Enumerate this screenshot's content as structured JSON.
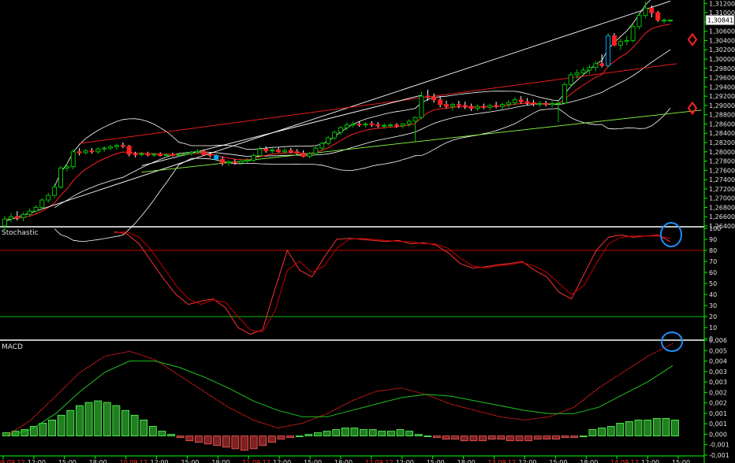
{
  "chart_data": [
    {
      "type": "candlestick",
      "title": "",
      "last_price_label": "1,30841",
      "price_axis_ticks": [
        "1,31200",
        "1,31000",
        "1,30800",
        "1,30600",
        "1,30400",
        "1,30200",
        "1,30000",
        "1,29800",
        "1,29600",
        "1,29400",
        "1,29200",
        "1,29000",
        "1,28800",
        "1,28600",
        "1,28400",
        "1,28200",
        "1,28000",
        "1,27800",
        "1,27600",
        "1,27400",
        "1,27200",
        "1,27000",
        "1,26800",
        "1,26600",
        "1,26400"
      ],
      "ylim": [
        1.264,
        1.3124
      ],
      "bar_count": 108,
      "ohlc": [
        [
          1.264,
          1.2662,
          1.263,
          1.2655
        ],
        [
          1.2655,
          1.2668,
          1.2648,
          1.266
        ],
        [
          1.266,
          1.2672,
          1.2652,
          1.2658
        ],
        [
          1.2658,
          1.267,
          1.265,
          1.2665
        ],
        [
          1.2665,
          1.2678,
          1.266,
          1.2672
        ],
        [
          1.2672,
          1.2685,
          1.2668,
          1.268
        ],
        [
          1.268,
          1.27,
          1.2676,
          1.2696
        ],
        [
          1.2696,
          1.2712,
          1.269,
          1.2706
        ],
        [
          1.2706,
          1.273,
          1.27,
          1.2724
        ],
        [
          1.2724,
          1.277,
          1.272,
          1.2765
        ],
        [
          1.2765,
          1.2775,
          1.2758,
          1.2768
        ],
        [
          1.2768,
          1.2806,
          1.2762,
          1.28
        ],
        [
          1.28,
          1.2808,
          1.2792,
          1.2798
        ],
        [
          1.2798,
          1.2806,
          1.2794,
          1.2802
        ],
        [
          1.2802,
          1.2808,
          1.2796,
          1.28
        ],
        [
          1.28,
          1.281,
          1.2795,
          1.2806
        ],
        [
          1.2806,
          1.2812,
          1.28,
          1.2808
        ],
        [
          1.2808,
          1.2815,
          1.2803,
          1.2811
        ],
        [
          1.2811,
          1.2818,
          1.2805,
          1.2814
        ],
        [
          1.2814,
          1.282,
          1.2808,
          1.2812
        ],
        [
          1.2812,
          1.2815,
          1.279,
          1.2795
        ],
        [
          1.2795,
          1.28,
          1.2788,
          1.2794
        ],
        [
          1.2794,
          1.28,
          1.279,
          1.2796
        ],
        [
          1.2796,
          1.28,
          1.279,
          1.2793
        ],
        [
          1.2793,
          1.2798,
          1.2789,
          1.2795
        ],
        [
          1.2795,
          1.2799,
          1.279,
          1.2792
        ],
        [
          1.2792,
          1.2797,
          1.2788,
          1.2794
        ],
        [
          1.2794,
          1.2798,
          1.279,
          1.2792
        ],
        [
          1.2792,
          1.2796,
          1.2789,
          1.2794
        ],
        [
          1.2794,
          1.2799,
          1.2791,
          1.2796
        ],
        [
          1.2796,
          1.2802,
          1.2792,
          1.2799
        ],
        [
          1.2799,
          1.2806,
          1.2795,
          1.2801
        ],
        [
          1.2801,
          1.2804,
          1.2792,
          1.2794
        ],
        [
          1.2794,
          1.2799,
          1.2788,
          1.2792
        ],
        [
          1.2792,
          1.2796,
          1.278,
          1.2784
        ],
        [
          1.2784,
          1.279,
          1.277,
          1.2776
        ],
        [
          1.2776,
          1.2782,
          1.277,
          1.2778
        ],
        [
          1.2778,
          1.2784,
          1.2772,
          1.2776
        ],
        [
          1.2776,
          1.2784,
          1.2772,
          1.278
        ],
        [
          1.278,
          1.2786,
          1.2776,
          1.2782
        ],
        [
          1.2782,
          1.2796,
          1.2778,
          1.2792
        ],
        [
          1.2792,
          1.2812,
          1.2788,
          1.2806
        ],
        [
          1.2806,
          1.2812,
          1.2798,
          1.2802
        ],
        [
          1.2802,
          1.2808,
          1.2796,
          1.2804
        ],
        [
          1.2804,
          1.281,
          1.2798,
          1.28
        ],
        [
          1.28,
          1.2808,
          1.2796,
          1.2803
        ],
        [
          1.2803,
          1.2808,
          1.2797,
          1.28
        ],
        [
          1.28,
          1.2806,
          1.2794,
          1.2797
        ],
        [
          1.2797,
          1.2803,
          1.2788,
          1.279
        ],
        [
          1.279,
          1.28,
          1.2786,
          1.2796
        ],
        [
          1.2796,
          1.2812,
          1.2792,
          1.2808
        ],
        [
          1.2808,
          1.2822,
          1.2804,
          1.2818
        ],
        [
          1.2818,
          1.2834,
          1.2814,
          1.283
        ],
        [
          1.283,
          1.2846,
          1.2826,
          1.2842
        ],
        [
          1.2842,
          1.2856,
          1.2836,
          1.2852
        ],
        [
          1.2852,
          1.2864,
          1.2846,
          1.2858
        ],
        [
          1.2858,
          1.2866,
          1.2852,
          1.286
        ],
        [
          1.286,
          1.2866,
          1.2854,
          1.2858
        ],
        [
          1.2858,
          1.2864,
          1.2852,
          1.286
        ],
        [
          1.286,
          1.2866,
          1.2854,
          1.2858
        ],
        [
          1.2858,
          1.2864,
          1.2852,
          1.2856
        ],
        [
          1.2856,
          1.2862,
          1.285,
          1.2857
        ],
        [
          1.2857,
          1.2862,
          1.2852,
          1.2858
        ],
        [
          1.2858,
          1.2862,
          1.2852,
          1.2856
        ],
        [
          1.2856,
          1.2862,
          1.285,
          1.286
        ],
        [
          1.286,
          1.287,
          1.2854,
          1.2866
        ],
        [
          1.2866,
          1.2876,
          1.2822,
          1.2874
        ],
        [
          1.2874,
          1.293,
          1.287,
          1.292
        ],
        [
          1.292,
          1.2934,
          1.291,
          1.2918
        ],
        [
          1.2918,
          1.2926,
          1.2906,
          1.2912
        ],
        [
          1.2912,
          1.292,
          1.2896,
          1.2902
        ],
        [
          1.2902,
          1.291,
          1.2894,
          1.2898
        ],
        [
          1.2898,
          1.2906,
          1.289,
          1.2902
        ],
        [
          1.2902,
          1.291,
          1.2894,
          1.29
        ],
        [
          1.29,
          1.2908,
          1.2892,
          1.2898
        ],
        [
          1.2898,
          1.2904,
          1.2888,
          1.2894
        ],
        [
          1.2894,
          1.2902,
          1.2888,
          1.2898
        ],
        [
          1.2898,
          1.2904,
          1.2892,
          1.2896
        ],
        [
          1.2896,
          1.2904,
          1.289,
          1.29
        ],
        [
          1.29,
          1.2908,
          1.2894,
          1.2898
        ],
        [
          1.2898,
          1.2906,
          1.2892,
          1.2902
        ],
        [
          1.2902,
          1.2912,
          1.2896,
          1.2906
        ],
        [
          1.2906,
          1.2918,
          1.29,
          1.2912
        ],
        [
          1.2912,
          1.292,
          1.2904,
          1.2908
        ],
        [
          1.2908,
          1.2916,
          1.29,
          1.2906
        ],
        [
          1.2906,
          1.2912,
          1.2898,
          1.2903
        ],
        [
          1.2903,
          1.291,
          1.2896,
          1.2904
        ],
        [
          1.2904,
          1.291,
          1.2898,
          1.2902
        ],
        [
          1.2902,
          1.291,
          1.2896,
          1.2904
        ],
        [
          1.2904,
          1.291,
          1.2864,
          1.2905
        ],
        [
          1.2905,
          1.295,
          1.2902,
          1.2945
        ],
        [
          1.2945,
          1.2972,
          1.294,
          1.2966
        ],
        [
          1.2966,
          1.2978,
          1.2958,
          1.297
        ],
        [
          1.297,
          1.2982,
          1.2962,
          1.2976
        ],
        [
          1.2976,
          1.2988,
          1.2968,
          1.2982
        ],
        [
          1.2982,
          1.2996,
          1.2974,
          1.299
        ],
        [
          1.299,
          1.301,
          1.2982,
          1.2986
        ],
        [
          1.2986,
          1.3056,
          1.2982,
          1.305
        ],
        [
          1.305,
          1.3056,
          1.3028,
          1.303
        ],
        [
          1.303,
          1.3044,
          1.302,
          1.3038
        ],
        [
          1.3038,
          1.305,
          1.303,
          1.304
        ],
        [
          1.304,
          1.3076,
          1.3036,
          1.307
        ],
        [
          1.307,
          1.31,
          1.3064,
          1.3094
        ],
        [
          1.3094,
          1.3124,
          1.3088,
          1.311
        ],
        [
          1.311,
          1.3116,
          1.309,
          1.31
        ],
        [
          1.31,
          1.3104,
          1.308,
          1.3084
        ],
        [
          1.3084,
          1.3088,
          1.3076,
          1.3084
        ],
        [
          1.3084,
          1.3086,
          1.308,
          1.3084
        ]
      ],
      "highlighted_bars": [
        34,
        97
      ],
      "signal_markers": [
        1.3042,
        1.2894
      ]
    },
    {
      "type": "line",
      "title": "Stochastic",
      "ylim": [
        0,
        100
      ],
      "axis_ticks": [
        "100",
        "90",
        "80",
        "70",
        "60",
        "50",
        "40",
        "30",
        "20",
        "10",
        "0"
      ],
      "levels": [
        80,
        20
      ],
      "series": [
        {
          "values": [
            97,
            95,
            86,
            70,
            54,
            40,
            31,
            34,
            36,
            28,
            10,
            4,
            8,
            45,
            80,
            62,
            56,
            74,
            90,
            91,
            90,
            89,
            88,
            89,
            86,
            87,
            85,
            78,
            68,
            64,
            65,
            67,
            68,
            70,
            62,
            56,
            42,
            36,
            58,
            80,
            92,
            94,
            92,
            93,
            94,
            88
          ]
        },
        {
          "values": [
            96,
            97,
            92,
            80,
            64,
            48,
            36,
            31,
            35,
            33,
            20,
            8,
            6,
            25,
            62,
            70,
            60,
            66,
            82,
            90,
            91,
            90,
            89,
            88,
            88,
            86,
            86,
            82,
            73,
            66,
            64,
            66,
            67,
            69,
            66,
            60,
            50,
            40,
            48,
            68,
            86,
            92,
            93,
            93,
            93,
            91
          ]
        }
      ]
    },
    {
      "type": "bar+line",
      "title": "MACD",
      "ylim": [
        -0.0012,
        0.006
      ],
      "axis_ticks": [
        "0,006",
        "0,005",
        "0,004",
        "0,003",
        "0,003",
        "0,002",
        "0,002",
        "0,001",
        "0,001",
        "0,000",
        "-0,001",
        "-0,001"
      ],
      "histogram": [
        0.0002,
        0.0003,
        0.0004,
        0.0006,
        0.0008,
        0.001,
        0.0013,
        0.0016,
        0.0019,
        0.0021,
        0.0022,
        0.0021,
        0.0019,
        0.0016,
        0.0013,
        0.001,
        0.0006,
        0.0003,
        0.0001,
        -0.0001,
        -0.0003,
        -0.0004,
        -0.0005,
        -0.0006,
        -0.0007,
        -0.0008,
        -0.0009,
        -0.0008,
        -0.0006,
        -0.0004,
        -0.0002,
        -0.0001,
        0.0,
        0.0001,
        0.0002,
        0.0003,
        0.0004,
        0.0005,
        0.0005,
        0.0004,
        0.0004,
        0.0003,
        0.0003,
        0.0004,
        0.0003,
        0.0001,
        0.0,
        -0.0001,
        -0.0002,
        -0.0002,
        -0.0003,
        -0.0003,
        -0.0003,
        -0.0002,
        -0.0002,
        -0.0003,
        -0.0003,
        -0.0003,
        -0.0002,
        -0.0002,
        -0.0002,
        -0.0001,
        -0.0001,
        0.0,
        0.0004,
        0.0005,
        0.0006,
        0.0008,
        0.0009,
        0.001,
        0.001,
        0.0011,
        0.0011,
        0.001
      ],
      "series": [
        {
          "values": [
            0.0,
            0.001,
            0.0025,
            0.004,
            0.005,
            0.0053,
            0.0048,
            0.0038,
            0.0028,
            0.0018,
            0.001,
            0.0005,
            0.0008,
            0.0014,
            0.0022,
            0.0028,
            0.003,
            0.0026,
            0.002,
            0.0016,
            0.0012,
            0.001,
            0.0012,
            0.0018,
            0.003,
            0.004,
            0.005,
            0.0058
          ]
        },
        {
          "values": [
            0.0,
            0.0004,
            0.0014,
            0.0028,
            0.004,
            0.0047,
            0.0047,
            0.0043,
            0.0037,
            0.003,
            0.0022,
            0.0016,
            0.0012,
            0.0012,
            0.0016,
            0.002,
            0.0024,
            0.0026,
            0.0025,
            0.0022,
            0.0019,
            0.0016,
            0.0014,
            0.0014,
            0.0018,
            0.0026,
            0.0034,
            0.0044
          ]
        }
      ]
    }
  ],
  "x_axis_labels": [
    "09.09.12",
    "12:00",
    "15:00",
    "18:00",
    "10.09.12",
    "12:00",
    "15:00",
    "18:00",
    "11.09.12",
    "12:00",
    "15:00",
    "18:00",
    "12.09.12",
    "12:00",
    "15:00",
    "18:00",
    "13.09.12",
    "12:00",
    "15:00",
    "18:00",
    "14.09.12",
    "12:00",
    "15:00"
  ],
  "colors": {
    "bull": "#00c000",
    "bear": "#ff2020",
    "highlight": "#00aaff",
    "axis": "#00ff00",
    "ema": "#ff2020",
    "band": "#ffffff",
    "trend_red": "#ff2020",
    "trend_green": "#90ff40",
    "marker": "#ff2020",
    "circle": "#1e90ff"
  }
}
